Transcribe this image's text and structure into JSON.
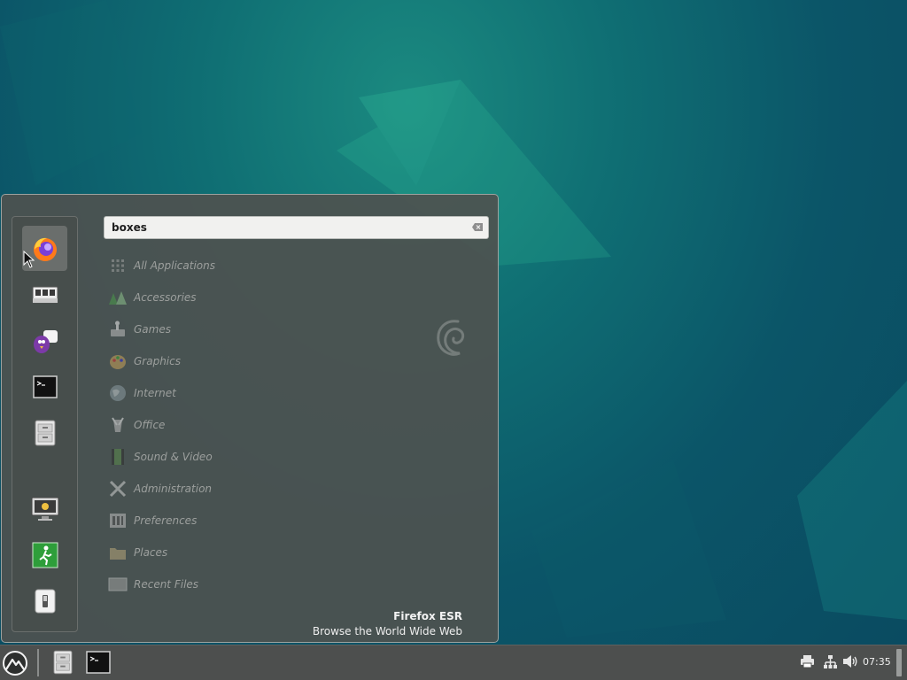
{
  "menu": {
    "search": {
      "value": "boxes",
      "placeholder": ""
    },
    "favorites": [
      {
        "name": "firefox",
        "icon": "firefox-icon"
      },
      {
        "name": "boxes",
        "icon": "boxes-icon"
      },
      {
        "name": "pidgin",
        "icon": "pidgin-icon"
      },
      {
        "name": "terminal",
        "icon": "terminal-icon"
      },
      {
        "name": "files",
        "icon": "file-cabinet-icon"
      }
    ],
    "session": [
      {
        "name": "lock-screen",
        "icon": "lock-screen-icon"
      },
      {
        "name": "logout",
        "icon": "logout-icon"
      },
      {
        "name": "shutdown",
        "icon": "power-switch-icon"
      }
    ],
    "categories": [
      {
        "label": "All Applications",
        "icon": "grid-icon"
      },
      {
        "label": "Accessories",
        "icon": "accessories-icon"
      },
      {
        "label": "Games",
        "icon": "games-icon"
      },
      {
        "label": "Graphics",
        "icon": "palette-icon"
      },
      {
        "label": "Internet",
        "icon": "globe-icon"
      },
      {
        "label": "Office",
        "icon": "office-icon"
      },
      {
        "label": "Sound & Video",
        "icon": "film-icon"
      },
      {
        "label": "Administration",
        "icon": "tools-icon"
      },
      {
        "label": "Preferences",
        "icon": "preferences-icon"
      },
      {
        "label": "Places",
        "icon": "folder-icon"
      },
      {
        "label": "Recent Files",
        "icon": "recent-files-icon"
      }
    ],
    "info": {
      "title": "Firefox ESR",
      "description": "Browse the World Wide Web"
    }
  },
  "panel": {
    "clock": "07:35",
    "launchers": [
      {
        "name": "files",
        "icon": "file-cabinet-icon"
      },
      {
        "name": "terminal",
        "icon": "terminal-icon"
      }
    ],
    "tray": [
      "printer-icon",
      "network-icon",
      "volume-icon"
    ]
  }
}
